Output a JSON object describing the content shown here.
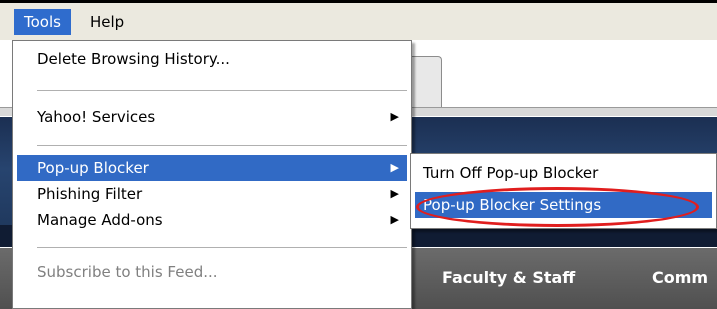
{
  "menubar": {
    "tools": "Tools",
    "help": "Help"
  },
  "tools_menu": {
    "items": [
      {
        "label": "Delete Browsing History...",
        "has_submenu": false,
        "state": "normal"
      },
      {
        "label": "Yahoo! Services",
        "has_submenu": true,
        "state": "normal"
      },
      {
        "label": "Pop-up Blocker",
        "has_submenu": true,
        "state": "selected"
      },
      {
        "label": "Phishing Filter",
        "has_submenu": true,
        "state": "normal"
      },
      {
        "label": "Manage Add-ons",
        "has_submenu": true,
        "state": "normal"
      },
      {
        "label": "Subscribe to this Feed...",
        "has_submenu": false,
        "state": "disabled"
      }
    ],
    "arrow_glyph": "▶"
  },
  "popup_blocker_submenu": {
    "items": [
      {
        "label": "Turn Off Pop-up Blocker",
        "state": "normal"
      },
      {
        "label": "Pop-up Blocker Settings",
        "state": "selected",
        "highlighted_by": "red-ellipse"
      }
    ]
  },
  "page_background": {
    "nav_items": [
      "Faculty & Staff",
      "Comm"
    ]
  },
  "colors": {
    "menu_selection": "#316ac5",
    "menubar": "#ebe9df",
    "highlight_ring": "#e01e1e",
    "page_nav": "#5a5a5a"
  }
}
